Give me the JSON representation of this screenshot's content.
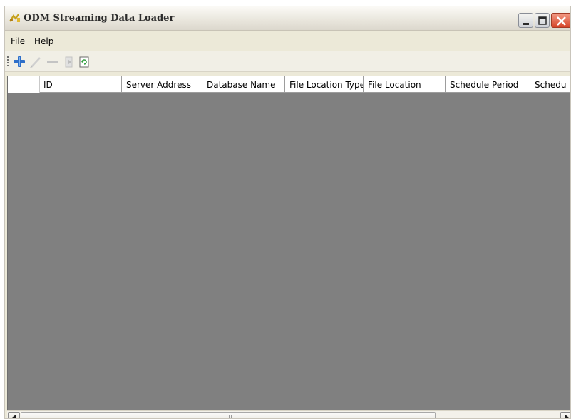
{
  "window": {
    "title": "ODM Streaming Data Loader",
    "icon": "app-icon",
    "controls": [
      "minimize-icon",
      "maximize-icon",
      "close-icon"
    ]
  },
  "menu": [
    {
      "label": "File"
    },
    {
      "label": "Help"
    }
  ],
  "toolbar": {
    "buttons": [
      {
        "name": "add",
        "icon": "plus-icon",
        "enabled": true
      },
      {
        "name": "edit",
        "icon": "pencil-icon",
        "enabled": false
      },
      {
        "name": "remove",
        "icon": "minus-icon",
        "enabled": false
      },
      {
        "name": "run",
        "icon": "run-icon",
        "enabled": false
      },
      {
        "name": "refresh",
        "icon": "refresh-icon",
        "enabled": true
      }
    ]
  },
  "grid": {
    "columns": [
      "ID",
      "Server Address",
      "Database Name",
      "File Location Type",
      "File Location",
      "Schedule Period",
      "Schedu"
    ],
    "rows": [],
    "background_color": "#808080"
  },
  "scrollbar": {
    "orientation": "horizontal"
  }
}
